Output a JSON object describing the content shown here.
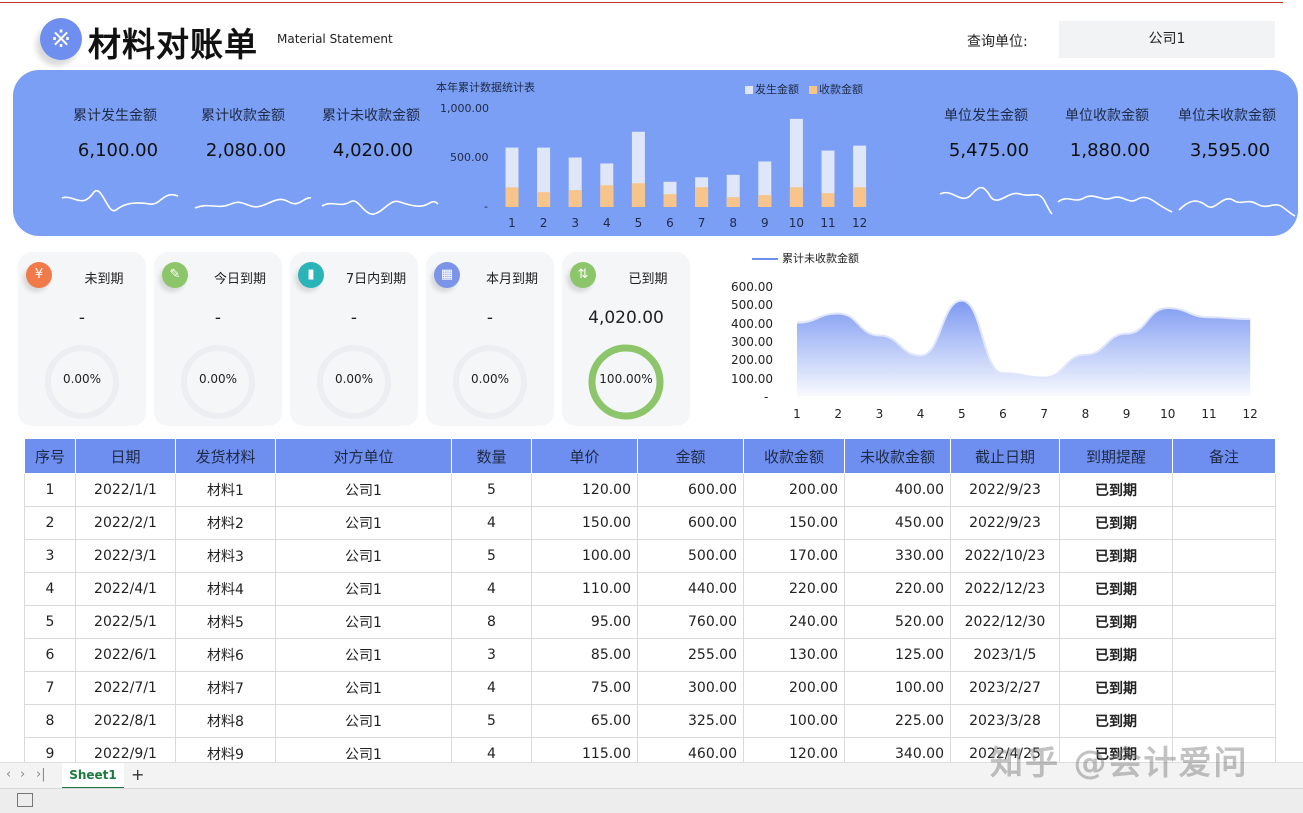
{
  "header": {
    "logo_glyph": "※",
    "title": "材料对账单",
    "subtitle": "Material Statement",
    "query_label": "查询单位:",
    "query_value": "公司1"
  },
  "stats_left": [
    {
      "label": "累计发生金额",
      "value": "6,100.00"
    },
    {
      "label": "累计收款金额",
      "value": "2,080.00"
    },
    {
      "label": "累计未收款金额",
      "value": "4,020.00"
    }
  ],
  "stats_right": [
    {
      "label": "单位发生金额",
      "value": "5,475.00"
    },
    {
      "label": "单位收款金额",
      "value": "1,880.00"
    },
    {
      "label": "单位未收款金额",
      "value": "3,595.00"
    }
  ],
  "bar_chart": {
    "title": "本年累计数据统计表",
    "legend": [
      "发生金额",
      "收款金额"
    ],
    "y_ticks": [
      "1,000.00",
      "500.00",
      "-"
    ]
  },
  "cards": [
    {
      "title": "未到期",
      "value": "-",
      "pct": "0.00%",
      "fraction": 0,
      "icon": "yuan-icon",
      "glyph": "¥",
      "color": "#f07a4a"
    },
    {
      "title": "今日到期",
      "value": "-",
      "pct": "0.00%",
      "fraction": 0,
      "icon": "edit-icon",
      "glyph": "✎",
      "color": "#8cc56a"
    },
    {
      "title": "7日内到期",
      "value": "-",
      "pct": "0.00%",
      "fraction": 0,
      "icon": "signal-icon",
      "glyph": "▮",
      "color": "#2ab4b8"
    },
    {
      "title": "本月到期",
      "value": "-",
      "pct": "0.00%",
      "fraction": 0,
      "icon": "grid-icon",
      "glyph": "▦",
      "color": "#7b94e8"
    },
    {
      "title": "已到期",
      "value": "4,020.00",
      "pct": "100.00%",
      "fraction": 1,
      "icon": "arrows-icon",
      "glyph": "⇅",
      "color": "#8cc56a"
    }
  ],
  "area_chart": {
    "legend": "累计未收款金额",
    "y_ticks": [
      "600.00",
      "500.00",
      "400.00",
      "300.00",
      "200.00",
      "100.00",
      "-"
    ]
  },
  "chart_data": [
    {
      "type": "bar",
      "title": "本年累计数据统计表",
      "categories": [
        "1",
        "2",
        "3",
        "4",
        "5",
        "6",
        "7",
        "8",
        "9",
        "10",
        "11",
        "12"
      ],
      "series": [
        {
          "name": "发生金额",
          "values": [
            600,
            600,
            500,
            440,
            760,
            255,
            300,
            325,
            460,
            890,
            570,
            620
          ]
        },
        {
          "name": "收款金额",
          "values": [
            200,
            150,
            170,
            220,
            240,
            130,
            200,
            100,
            120,
            200,
            140,
            200
          ]
        }
      ],
      "ylim": [
        0,
        1000
      ],
      "legend_position": "top-right"
    },
    {
      "type": "area",
      "categories": [
        "1",
        "2",
        "3",
        "4",
        "5",
        "6",
        "7",
        "8",
        "9",
        "10",
        "11",
        "12"
      ],
      "series": [
        {
          "name": "累计未收款金额",
          "values": [
            400,
            450,
            330,
            220,
            520,
            125,
            100,
            225,
            340,
            480,
            430,
            420
          ]
        }
      ],
      "ylim": [
        0,
        600
      ],
      "legend_position": "top-left"
    }
  ],
  "table": {
    "headers": [
      "序号",
      "日期",
      "发货材料",
      "对方单位",
      "数量",
      "单价",
      "金额",
      "收款金额",
      "未收款金额",
      "截止日期",
      "到期提醒",
      "备注"
    ],
    "rows": [
      [
        "1",
        "2022/1/1",
        "材料1",
        "公司1",
        "5",
        "120.00",
        "600.00",
        "200.00",
        "400.00",
        "2022/9/23",
        "已到期",
        ""
      ],
      [
        "2",
        "2022/2/1",
        "材料2",
        "公司1",
        "4",
        "150.00",
        "600.00",
        "150.00",
        "450.00",
        "2022/9/23",
        "已到期",
        ""
      ],
      [
        "3",
        "2022/3/1",
        "材料3",
        "公司1",
        "5",
        "100.00",
        "500.00",
        "170.00",
        "330.00",
        "2022/10/23",
        "已到期",
        ""
      ],
      [
        "4",
        "2022/4/1",
        "材料4",
        "公司1",
        "4",
        "110.00",
        "440.00",
        "220.00",
        "220.00",
        "2022/12/23",
        "已到期",
        ""
      ],
      [
        "5",
        "2022/5/1",
        "材料5",
        "公司1",
        "8",
        "95.00",
        "760.00",
        "240.00",
        "520.00",
        "2022/12/30",
        "已到期",
        ""
      ],
      [
        "6",
        "2022/6/1",
        "材料6",
        "公司1",
        "3",
        "85.00",
        "255.00",
        "130.00",
        "125.00",
        "2023/1/5",
        "已到期",
        ""
      ],
      [
        "7",
        "2022/7/1",
        "材料7",
        "公司1",
        "4",
        "75.00",
        "300.00",
        "200.00",
        "100.00",
        "2023/2/27",
        "已到期",
        ""
      ],
      [
        "8",
        "2022/8/1",
        "材料8",
        "公司1",
        "5",
        "65.00",
        "325.00",
        "100.00",
        "225.00",
        "2023/3/28",
        "已到期",
        ""
      ],
      [
        "9",
        "2022/9/1",
        "材料9",
        "公司1",
        "4",
        "115.00",
        "460.00",
        "120.00",
        "340.00",
        "2022/4/25",
        "已到期",
        ""
      ]
    ]
  },
  "sheet": {
    "tab": "Sheet1",
    "add": "+",
    "nav_prev": "‹",
    "nav_next": "›",
    "nav_last": "›|"
  },
  "watermark": "知乎 @会计爱问",
  "colors": {
    "band": "#7a9ff5",
    "bar_issued": "#dfe6f7",
    "bar_received": "#f7c58c",
    "due": "#e8743b",
    "area": "#6f8ff0"
  }
}
